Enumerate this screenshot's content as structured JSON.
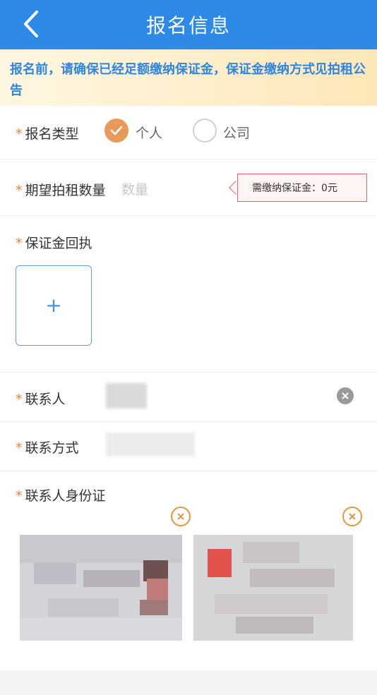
{
  "header": {
    "title": "报名信息",
    "back_icon": "chevron-left-icon"
  },
  "notice": {
    "text": "报名前，请确保已经足额缴纳保证金，保证金缴纳方式见拍租公告"
  },
  "form": {
    "required_mark": "*",
    "type": {
      "label": "报名类型",
      "options": [
        {
          "label": "个人",
          "selected": true
        },
        {
          "label": "公司",
          "selected": false
        }
      ]
    },
    "quantity": {
      "label": "期望拍租数量",
      "placeholder": "数量",
      "deposit_text": "需缴纳保证金：0元"
    },
    "receipt": {
      "label": "保证金回执",
      "upload_symbol": "+"
    },
    "contact": {
      "label": "联系人"
    },
    "phone": {
      "label": "联系方式"
    },
    "id_card": {
      "label": "联系人身份证"
    }
  },
  "colors": {
    "header_bg": "#2d8ae6",
    "notice_text": "#2f86e0",
    "accent_orange": "#e89a5b",
    "required_star": "#e8833a",
    "deposit_border": "#e0666c"
  }
}
